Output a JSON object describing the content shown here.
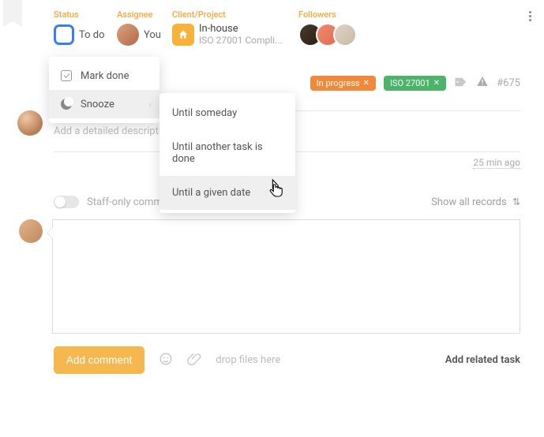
{
  "header": {
    "status_label": "Status",
    "assignee_label": "Assignee",
    "project_label": "Client/Project",
    "followers_label": "Followers",
    "status_value": "To do",
    "assignee_value": "You",
    "project_title": "In-house",
    "project_subtitle": "ISO 27001 Compli..."
  },
  "tags": {
    "in_progress": "In progress",
    "iso": "ISO 27001"
  },
  "task_id": "#675",
  "desc_placeholder": "Add a detailed description...",
  "timestamp": "25 min ago",
  "staff_toggle_label": "Staff-only comment",
  "show_all_label": "Show all records",
  "add_comment_label": "Add comment",
  "drop_files_label": "drop files here",
  "related_label": "Add related task",
  "menu": {
    "mark_done": "Mark done",
    "snooze": "Snooze",
    "snooze_sub": {
      "someday": "Until someday",
      "another": "Until another task is done",
      "date": "Until a given date"
    }
  }
}
